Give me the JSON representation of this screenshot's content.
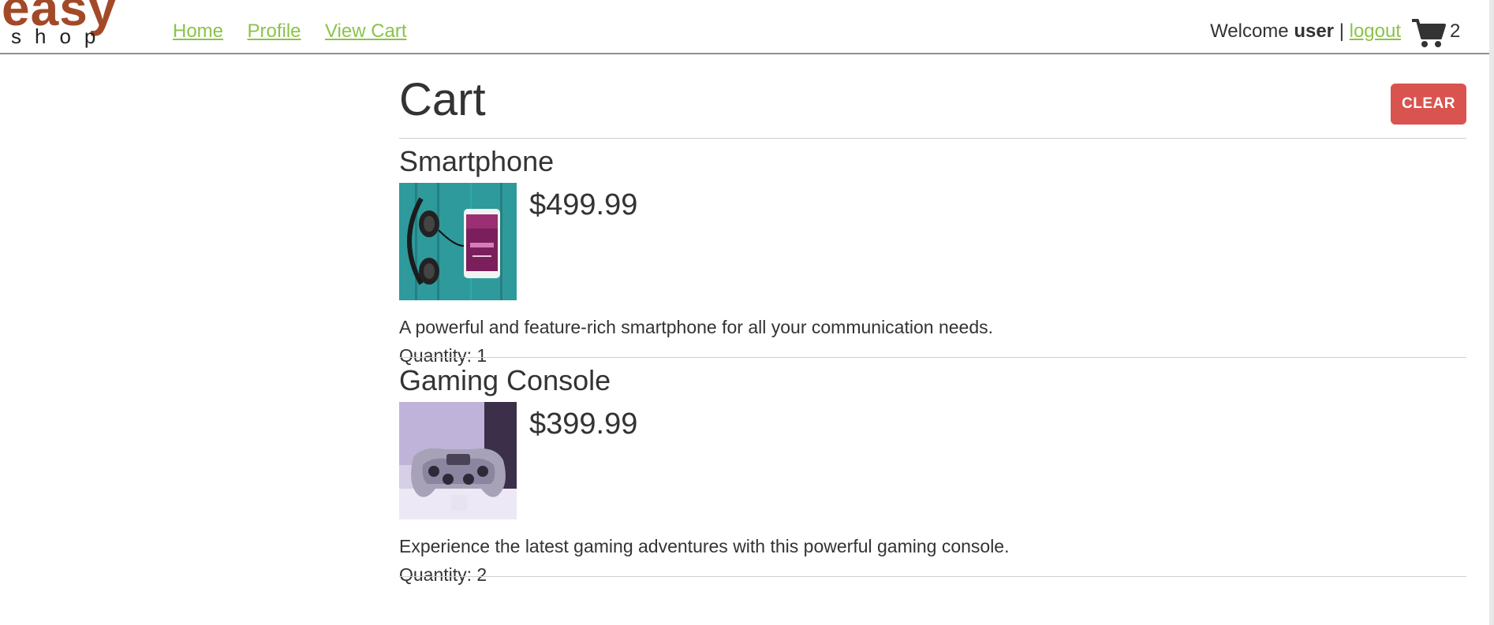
{
  "brand": {
    "logo_top": "easy",
    "logo_bottom": "shop"
  },
  "nav": {
    "items": [
      {
        "label": "Home"
      },
      {
        "label": "Profile"
      },
      {
        "label": "View Cart"
      }
    ]
  },
  "user": {
    "welcome_label": "Welcome",
    "username": "user",
    "separator": "|",
    "logout_label": "logout",
    "cart_count": "2"
  },
  "cart": {
    "title": "Cart",
    "clear_label": "CLEAR",
    "items": [
      {
        "name": "Smartphone",
        "price": "$499.99",
        "description": "A powerful and feature-rich smartphone for all your communication needs.",
        "quantity_label": "Quantity: 1",
        "image_icon": "smartphone-with-headphones-image"
      },
      {
        "name": "Gaming Console",
        "price": "$399.99",
        "description": "Experience the latest gaming adventures with this powerful gaming console.",
        "quantity_label": "Quantity: 2",
        "image_icon": "game-controller-image"
      }
    ]
  },
  "colors": {
    "link": "#8bc34a",
    "logo_brand": "#a24a28",
    "clear_button": "#d9534f",
    "text": "#333333"
  }
}
